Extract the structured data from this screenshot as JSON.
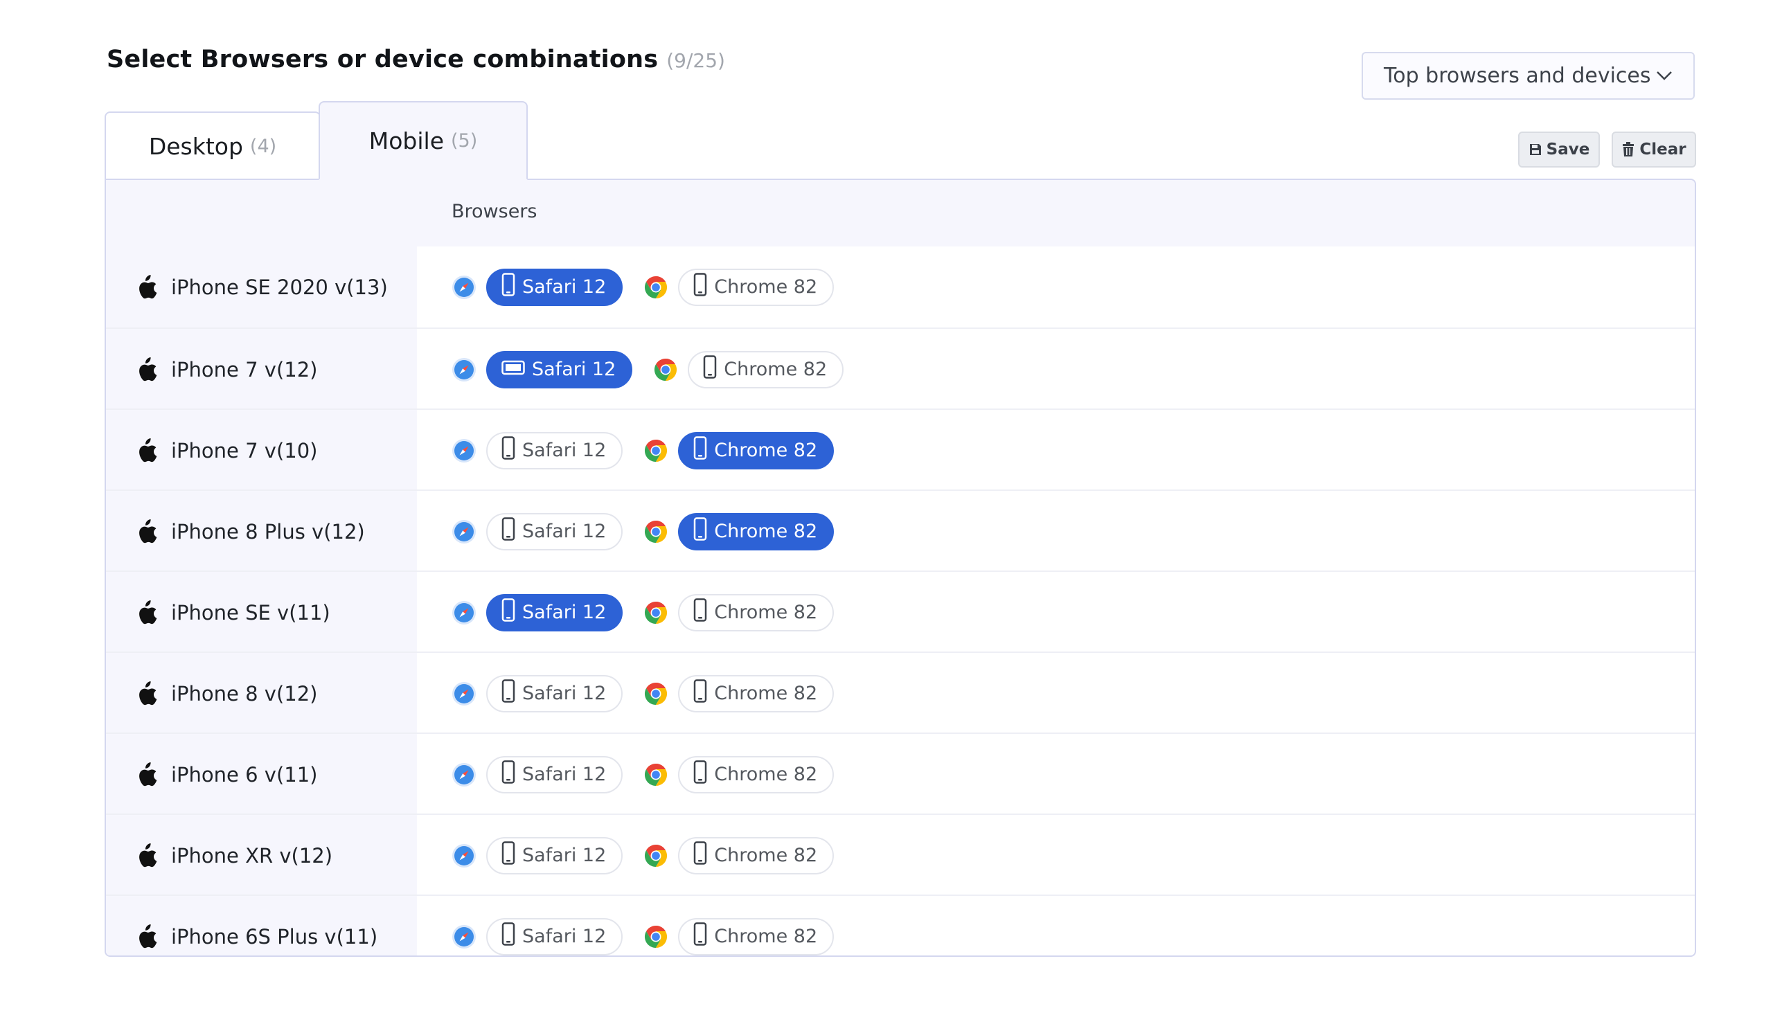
{
  "header": {
    "title": "Select Browsers or device combinations",
    "count": "(9/25)",
    "preset_dropdown": "Top browsers and devices"
  },
  "tabs": [
    {
      "label": "Desktop",
      "count": "(4)",
      "active": false
    },
    {
      "label": "Mobile",
      "count": "(5)",
      "active": true
    }
  ],
  "actions": {
    "save": "Save",
    "clear": "Clear"
  },
  "table": {
    "browsers_header": "Browsers",
    "rows": [
      {
        "device": "iPhone SE 2020 v(13)",
        "safari": "Safari 12",
        "chrome": "Chrome 82",
        "safari_selected": true,
        "chrome_selected": false,
        "safari_orientation": "portrait"
      },
      {
        "device": "iPhone 7 v(12)",
        "safari": "Safari 12",
        "chrome": "Chrome 82",
        "safari_selected": true,
        "chrome_selected": false,
        "safari_orientation": "landscape"
      },
      {
        "device": "iPhone 7 v(10)",
        "safari": "Safari 12",
        "chrome": "Chrome 82",
        "safari_selected": false,
        "chrome_selected": true,
        "safari_orientation": "portrait"
      },
      {
        "device": "iPhone 8 Plus v(12)",
        "safari": "Safari 12",
        "chrome": "Chrome 82",
        "safari_selected": false,
        "chrome_selected": true,
        "safari_orientation": "portrait"
      },
      {
        "device": "iPhone SE v(11)",
        "safari": "Safari 12",
        "chrome": "Chrome 82",
        "safari_selected": true,
        "chrome_selected": false,
        "safari_orientation": "portrait"
      },
      {
        "device": "iPhone 8 v(12)",
        "safari": "Safari 12",
        "chrome": "Chrome 82",
        "safari_selected": false,
        "chrome_selected": false,
        "safari_orientation": "portrait"
      },
      {
        "device": "iPhone 6 v(11)",
        "safari": "Safari 12",
        "chrome": "Chrome 82",
        "safari_selected": false,
        "chrome_selected": false,
        "safari_orientation": "portrait"
      },
      {
        "device": "iPhone XR v(12)",
        "safari": "Safari 12",
        "chrome": "Chrome 82",
        "safari_selected": false,
        "chrome_selected": false,
        "safari_orientation": "portrait"
      },
      {
        "device": "iPhone 6S Plus v(11)",
        "safari": "Safari 12",
        "chrome": "Chrome 82",
        "safari_selected": false,
        "chrome_selected": false,
        "safari_orientation": "portrait"
      }
    ]
  },
  "icons": {
    "device_os": "apple-icon",
    "browser_1": "safari-icon",
    "browser_2": "chrome-icon",
    "device_form": "phone-icon"
  },
  "colors": {
    "accent": "#2d62d6",
    "panel_bg": "#f6f6fd",
    "border": "#d4d7ef"
  }
}
